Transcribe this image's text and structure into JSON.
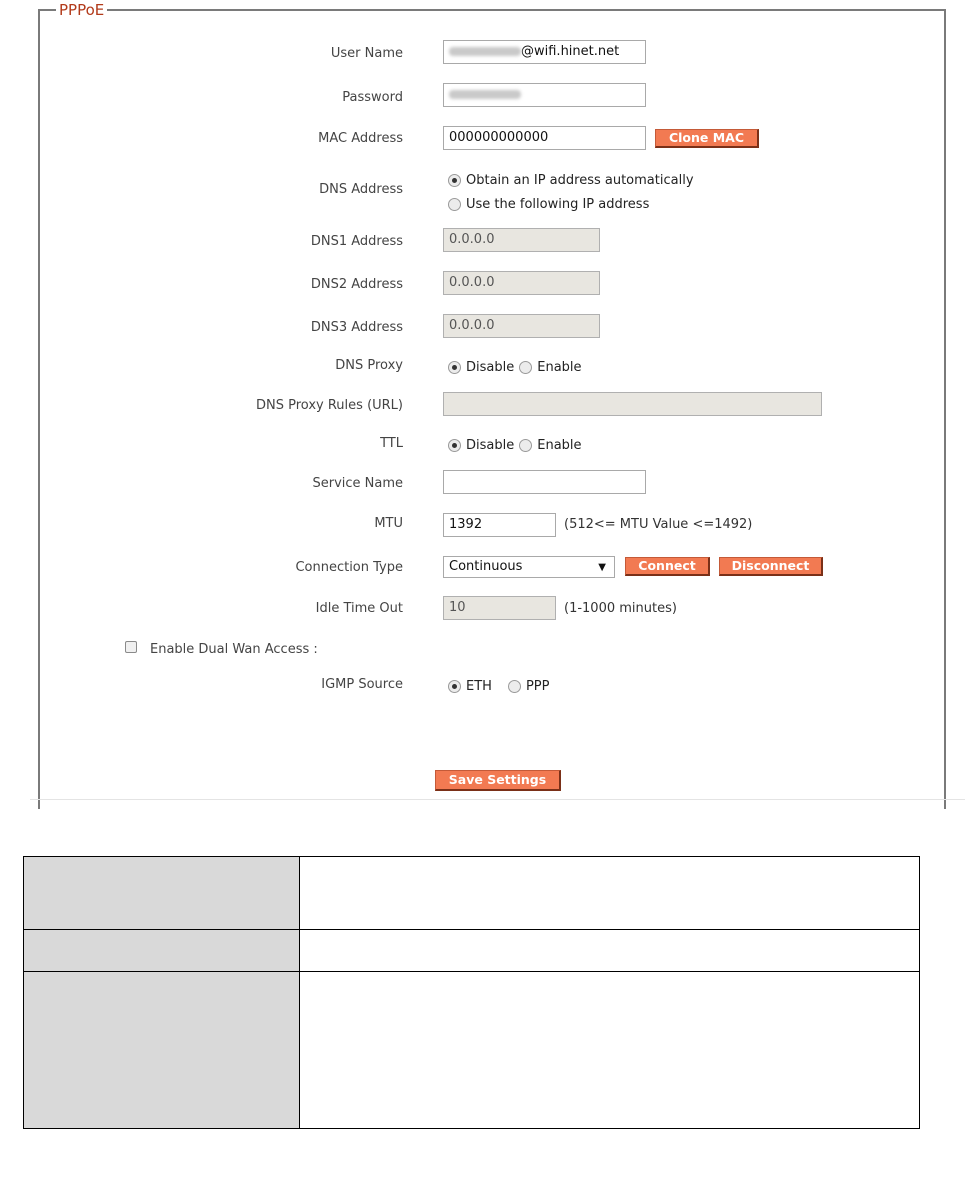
{
  "legend": "PPPoE",
  "fields": {
    "user_name": {
      "label": "User Name",
      "value_suffix": "@wifi.hinet.net"
    },
    "password": {
      "label": "Password"
    },
    "mac_address": {
      "label": "MAC Address",
      "value": "000000000000",
      "button": "Clone MAC"
    },
    "dns_address": {
      "label": "DNS  Address",
      "options": [
        "Obtain an IP address automatically",
        "Use the following IP address"
      ],
      "selected": 0
    },
    "dns1": {
      "label": "DNS1  Address",
      "value": "0.0.0.0"
    },
    "dns2": {
      "label": "DNS2  Address",
      "value": "0.0.0.0"
    },
    "dns3": {
      "label": "DNS3  Address",
      "value": "0.0.0.0"
    },
    "dns_proxy": {
      "label": "DNS Proxy",
      "options": [
        "Disable",
        "Enable"
      ],
      "selected": 0
    },
    "dns_proxy_rules": {
      "label": "DNS Proxy Rules (URL)",
      "value": ""
    },
    "ttl": {
      "label": "TTL",
      "options": [
        "Disable",
        "Enable"
      ],
      "selected": 0
    },
    "service_name": {
      "label": "Service Name",
      "value": ""
    },
    "mtu": {
      "label": "MTU",
      "value": "1392",
      "hint": "(512<= MTU  Value <=1492)"
    },
    "connection_type": {
      "label": "Connection Type",
      "value": "Continuous",
      "connect": "Connect",
      "disconnect": "Disconnect"
    },
    "idle_time_out": {
      "label": "Idle Time Out",
      "value": "10",
      "hint": "(1-1000 minutes)"
    },
    "dual_wan": {
      "label": "Enable  Dual Wan Access  :",
      "checked": false
    },
    "igmp_source": {
      "label": "IGMP Source",
      "options": [
        "ETH",
        "PPP"
      ],
      "selected": 0
    }
  },
  "save_button": "Save Settings",
  "colors": {
    "button": "#f27a52",
    "legend": "#b23a1a",
    "disabled_input": "#e8e6e0",
    "table_header_cell": "#d9d9d9"
  }
}
